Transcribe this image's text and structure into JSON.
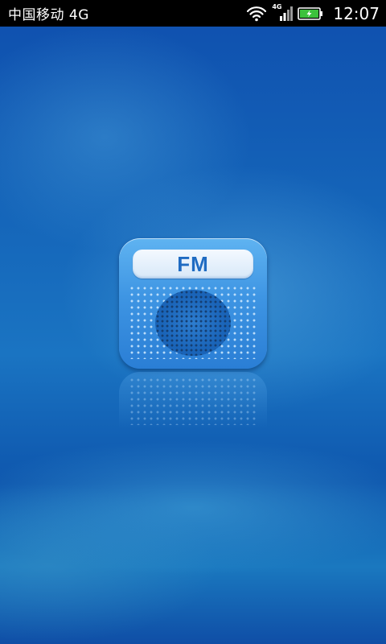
{
  "status_bar": {
    "carrier": "中国移动 4G",
    "network_type": "4G",
    "time": "12:07",
    "icons": [
      "wifi-icon",
      "cell-signal-icon",
      "battery-charging-icon"
    ]
  },
  "app_icon": {
    "label": "FM"
  },
  "colors": {
    "background": "#1463b8",
    "icon_body": "#3e95e3",
    "icon_label_text": "#1f6bc2",
    "battery_fill": "#3cc23c"
  }
}
